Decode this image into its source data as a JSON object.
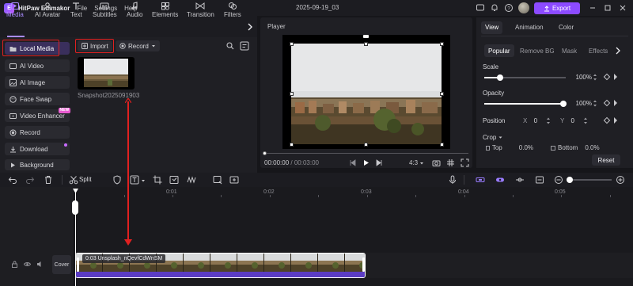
{
  "window": {
    "app_name": "HitPaw Edimakor",
    "menu": [
      "File",
      "Settings",
      "Help"
    ],
    "title": "2025-09-19_03",
    "export_label": "Export",
    "accent_color": "#8c4bff"
  },
  "toolbar": {
    "tabs": [
      {
        "label": "Media",
        "icon": "media-icon",
        "active": true
      },
      {
        "label": "AI Avatar",
        "icon": "ai-avatar-icon"
      },
      {
        "label": "Text",
        "icon": "text-icon"
      },
      {
        "label": "Subtitles",
        "icon": "subtitles-icon"
      },
      {
        "label": "Audio",
        "icon": "audio-icon"
      },
      {
        "label": "Elements",
        "icon": "elements-icon"
      },
      {
        "label": "Transition",
        "icon": "transition-icon"
      },
      {
        "label": "Filters",
        "icon": "filters-icon"
      }
    ]
  },
  "sidebar": {
    "items": [
      {
        "label": "Local Media",
        "icon": "folder-icon",
        "active": true
      },
      {
        "label": "AI Video",
        "icon": "ai-video-icon"
      },
      {
        "label": "AI Image",
        "icon": "ai-image-icon"
      },
      {
        "label": "Face Swap",
        "icon": "face-swap-icon"
      },
      {
        "label": "Video Enhancer",
        "icon": "enhancer-icon",
        "badge": "NEW"
      },
      {
        "label": "Record",
        "icon": "record-icon"
      },
      {
        "label": "Download",
        "icon": "download-icon"
      },
      {
        "label": "Background",
        "icon": "background-icon"
      }
    ]
  },
  "media": {
    "import_label": "Import",
    "record_label": "Record",
    "file_name": "Snapshot2025091903"
  },
  "player": {
    "title": "Player",
    "current_time": "00:00:00",
    "separator": "/",
    "total_time": "00:03:00",
    "aspect": "4:3"
  },
  "inspector": {
    "tabs": [
      "View",
      "Animation",
      "Color"
    ],
    "subtabs": [
      "Popular",
      "Remove BG",
      "Mask",
      "Effects"
    ],
    "scale_label": "Scale",
    "scale_value": "100%",
    "opacity_label": "Opacity",
    "opacity_value": "100%",
    "position_label": "Position",
    "pos_x_label": "X",
    "pos_x": "0",
    "pos_y_label": "Y",
    "pos_y": "0",
    "crop_label": "Crop",
    "crop_top_label": "Top",
    "crop_top_value": "0.0%",
    "crop_bottom_label": "Bottom",
    "crop_bottom_value": "0.0%",
    "reset_label": "Reset"
  },
  "timeline": {
    "split_label": "Split",
    "ruler": [
      "0:01",
      "0:02",
      "0:03",
      "0:04",
      "0:05"
    ],
    "clip_label": "0:03 Unsplash_nQevfCdWnSM",
    "cover_label": "Cover"
  }
}
